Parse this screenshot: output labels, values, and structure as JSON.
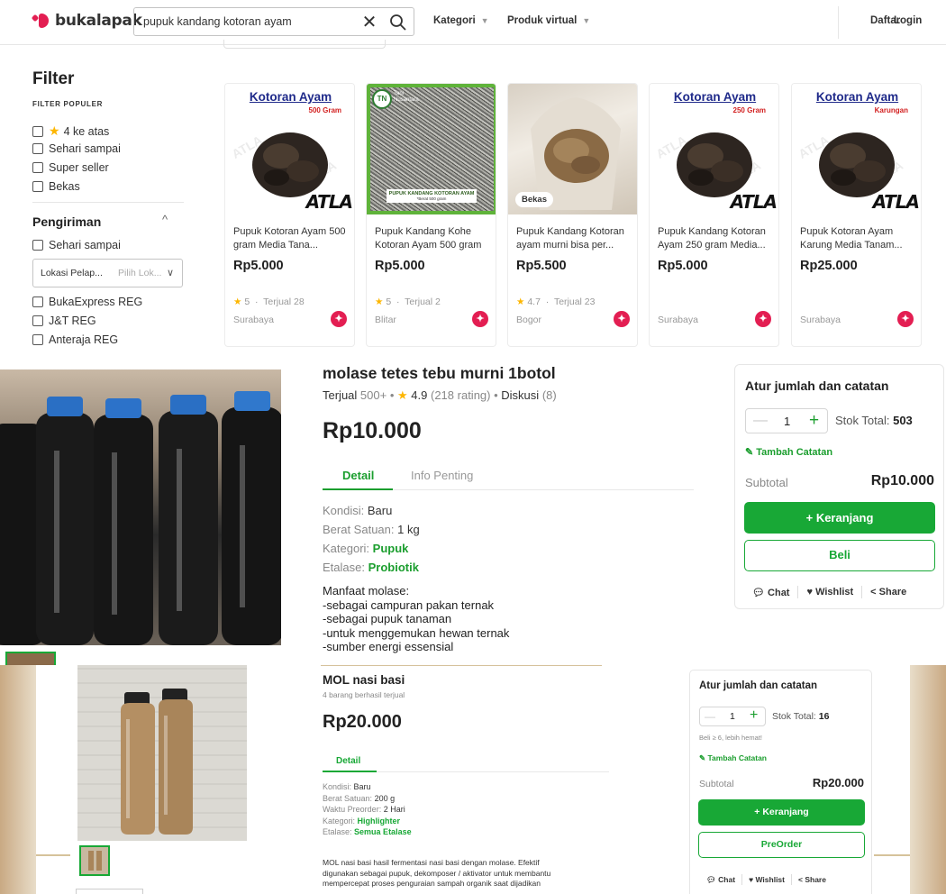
{
  "search_page": {
    "logo_text": "bukalapak",
    "search": {
      "value": "pupuk kandang kotoran ayam",
      "clear_icon": "close-icon",
      "submit_icon": "search-icon"
    },
    "nav": {
      "kategori": "Kategori",
      "produk_virtual": "Produk virtual",
      "daftar": "Daftar",
      "login": "Login"
    },
    "filter": {
      "title": "Filter",
      "popular_label": "FILTER POPULER",
      "popular": [
        "4 ke atas",
        "Sehari sampai",
        "Super seller",
        "Bekas"
      ],
      "shipping_title": "Pengiriman",
      "shipping_sameday": "Sehari sampai",
      "location_select": {
        "value": "Lokasi Pelap...",
        "placeholder": "Pilih Lok..."
      },
      "couriers": [
        "BukaExpress REG",
        "J&T REG",
        "Anteraja REG"
      ]
    },
    "products": [
      {
        "name": "Pupuk Kotoran Ayam 500 gram Media Tana...",
        "price": "Rp5.000",
        "rating": "5",
        "sold": "Terjual 28",
        "city": "Surabaya",
        "image_title": "Kotoran Ayam",
        "image_sub": "500 Gram",
        "image_brand": "ATLA"
      },
      {
        "name": "Pupuk Kandang Kohe Kotoran Ayam 500 gram",
        "price": "Rp5.000",
        "rating": "5",
        "sold": "Terjual 2",
        "city": "Blitar",
        "image_caption": "PUPUK KANDANG KOTORAN AYAM",
        "image_caption2": "*Berat 500 gram",
        "image_logo": "Tani Nusantara"
      },
      {
        "name": "Pupuk Kandang Kotoran ayam murni bisa per...",
        "price": "Rp5.500",
        "rating": "4.7",
        "sold": "Terjual 23",
        "city": "Bogor",
        "badge_label": "Bekas"
      },
      {
        "name": "Pupuk Kandang Kotoran Ayam 250 gram Media...",
        "price": "Rp5.000",
        "city": "Surabaya",
        "image_title": "Kotoran Ayam",
        "image_sub": "250 Gram",
        "image_brand": "ATLA"
      },
      {
        "name": "Pupuk Kotoran Ayam Karung Media Tanam...",
        "price": "Rp25.000",
        "city": "Surabaya",
        "image_title": "Kotoran Ayam",
        "image_sub": "Karungan",
        "image_brand": "ATLA"
      }
    ]
  },
  "product_molase": {
    "title": "molase tetes tebu murni 1botol",
    "sold_label": "Terjual",
    "sold_value": "500+",
    "rating": "4.9",
    "rating_count": "(218 rating)",
    "discussion_label": "Diskusi",
    "discussion_count": "(8)",
    "price": "Rp10.000",
    "tabs": [
      "Detail",
      "Info Penting"
    ],
    "details": [
      {
        "label": "Kondisi:",
        "value": "Baru"
      },
      {
        "label": "Berat Satuan:",
        "value": "1 kg"
      },
      {
        "label": "Kategori:",
        "value": "Pupuk"
      },
      {
        "label": "Etalase:",
        "value": "Probiotik"
      }
    ],
    "description": [
      "Manfaat molase:",
      "-sebagai campuran pakan ternak",
      "-sebagai pupuk tanaman",
      "-untuk menggemukan hewan ternak",
      "-sumber energi essensial"
    ],
    "cart_box": {
      "title": "Atur jumlah dan catatan",
      "qty": "1",
      "stock_label": "Stok Total:",
      "stock_value": "503",
      "note_label": "Tambah Catatan",
      "subtotal_label": "Subtotal",
      "subtotal_value": "Rp10.000",
      "cart_button": "+ Keranjang",
      "buy_button": "Beli",
      "chat": "Chat",
      "wishlist": "Wishlist",
      "share": "Share"
    }
  },
  "product_mol": {
    "title": "MOL nasi basi",
    "sold_info": "4 barang berhasil terjual",
    "price": "Rp20.000",
    "tab": "Detail",
    "details": [
      {
        "label": "Kondisi:",
        "value": "Baru"
      },
      {
        "label": "Berat Satuan:",
        "value": "200 g"
      },
      {
        "label": "Waktu Preorder:",
        "value": "2 Hari"
      },
      {
        "label": "Kategori:",
        "value": "Highlighter"
      },
      {
        "label": "Etalase:",
        "value": "Semua Etalase"
      }
    ],
    "description": [
      "MOL nasi basi hasil fermentasi nasi basi dengan molase. Efektif",
      "digunakan sebagai pupuk, dekomposer / aktivator untuk membantu",
      "mempercepat proses penguraian sampah organik saat dijadikan"
    ],
    "cart_box": {
      "title": "Atur jumlah dan catatan",
      "qty": "1",
      "stock_label": "Stok Total:",
      "stock_value": "16",
      "promo": "Beli ≥ 6, lebih hemat!",
      "note_label": "Tambah Catatan",
      "subtotal_label": "Subtotal",
      "subtotal_value": "Rp20.000",
      "cart_button": "+ Keranjang",
      "preorder_button": "PreOrder",
      "chat": "Chat",
      "wishlist": "Wishlist",
      "share": "Share"
    }
  },
  "colors": {
    "brand": "#e31e52",
    "green": "#18a836",
    "star": "#fdb600"
  }
}
